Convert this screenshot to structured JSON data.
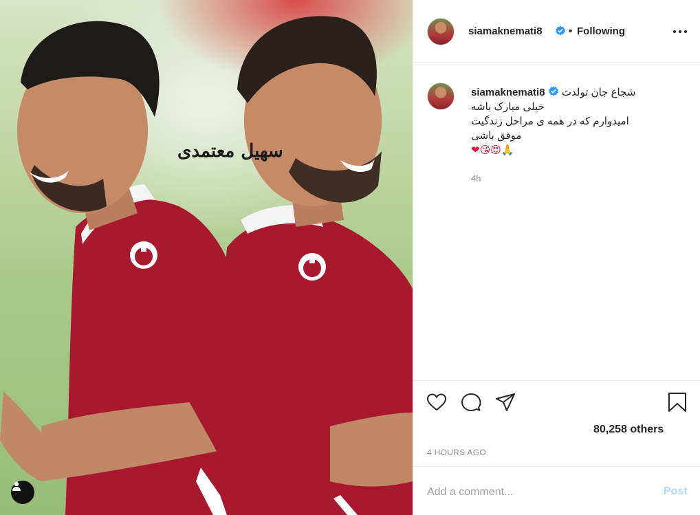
{
  "post": {
    "photo_alt": "two players in red jerseys",
    "photo_signature": "سهیل معتمدی"
  },
  "header": {
    "username": "siamaknemati8",
    "separator": "•",
    "follow_label": "Following",
    "more_icon": "more-horizontal-icon",
    "verified_icon": "verified-badge-icon"
  },
  "caption": {
    "username": "siamaknemati8",
    "lines": [
      "شجاع جان تولدت",
      "خیلی مبارک باشه",
      "امیدوارم که در همه ی مراحل زندگیت",
      "موفق باشی"
    ],
    "emojis": "❤😘😍🙏",
    "time": "4h"
  },
  "actions": {
    "like_icon": "heart-icon",
    "comment_icon": "comment-icon",
    "share_icon": "share-icon",
    "save_icon": "bookmark-icon",
    "likes_text": "80,258 others",
    "time_ago": "4 HOURS AGO"
  },
  "comment": {
    "placeholder": "Add a comment...",
    "post_label": "Post"
  },
  "colors": {
    "verified": "#3897f0",
    "jersey": "#a8192f",
    "post_disabled": "#b3dbff",
    "muted": "#8e8e8e"
  }
}
